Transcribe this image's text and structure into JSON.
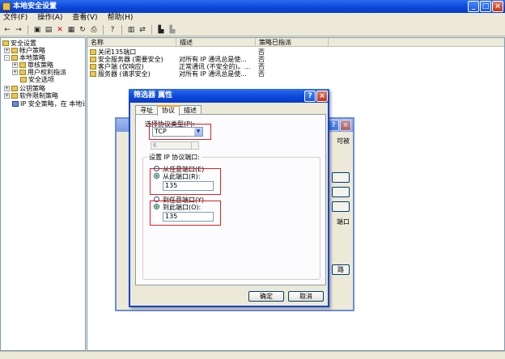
{
  "window": {
    "title": "本地安全设置"
  },
  "menu": [
    "文件(F)",
    "操作(A)",
    "查看(V)",
    "帮助(H)"
  ],
  "tree": [
    {
      "label": "安全设置",
      "exp": ""
    },
    {
      "label": "帐户策略",
      "exp": "+"
    },
    {
      "label": "本地策略",
      "exp": "-"
    },
    {
      "label": "审核策略",
      "exp": "+"
    },
    {
      "label": "用户权利指派",
      "exp": "+"
    },
    {
      "label": "安全选项",
      "exp": ""
    },
    {
      "label": "公钥策略",
      "exp": "+"
    },
    {
      "label": "软件限制策略",
      "exp": "+"
    },
    {
      "label": "IP 安全策略，在 本地计",
      "exp": ""
    }
  ],
  "list": {
    "columns": [
      "名称",
      "描述",
      "策略已指派"
    ],
    "rows": [
      {
        "name": "关闭135端口",
        "desc": "",
        "assigned": "否"
      },
      {
        "name": "安全服务器 (需要安全)",
        "desc": "对所有 IP 通讯总是使...",
        "assigned": "否"
      },
      {
        "name": "客户端 (仅响应)",
        "desc": "正常通讯 (不安全的)。...",
        "assigned": "否"
      },
      {
        "name": "服务器 (请求安全)",
        "desc": "对所有 IP 通讯总是使...",
        "assigned": "否"
      }
    ]
  },
  "bg_dialog": {
    "right_text": "可被",
    "right_label": "端口",
    "right_btn": "路"
  },
  "dialog": {
    "title": "筛选器 属性",
    "tabs": [
      "寻址",
      "协议",
      "描述"
    ],
    "protocol_label": "选择协议类型(P):",
    "protocol_value": "TCP",
    "spin_value": "6",
    "port_group_label": "设置 IP 协议端口:",
    "src_any": "从任意端口(E)",
    "src_this": "从此端口(R):",
    "src_port": "135",
    "dst_any": "到任意端口(Y)",
    "dst_this": "到此端口(O):",
    "dst_port": "135",
    "ok": "确定",
    "cancel": "取消"
  }
}
